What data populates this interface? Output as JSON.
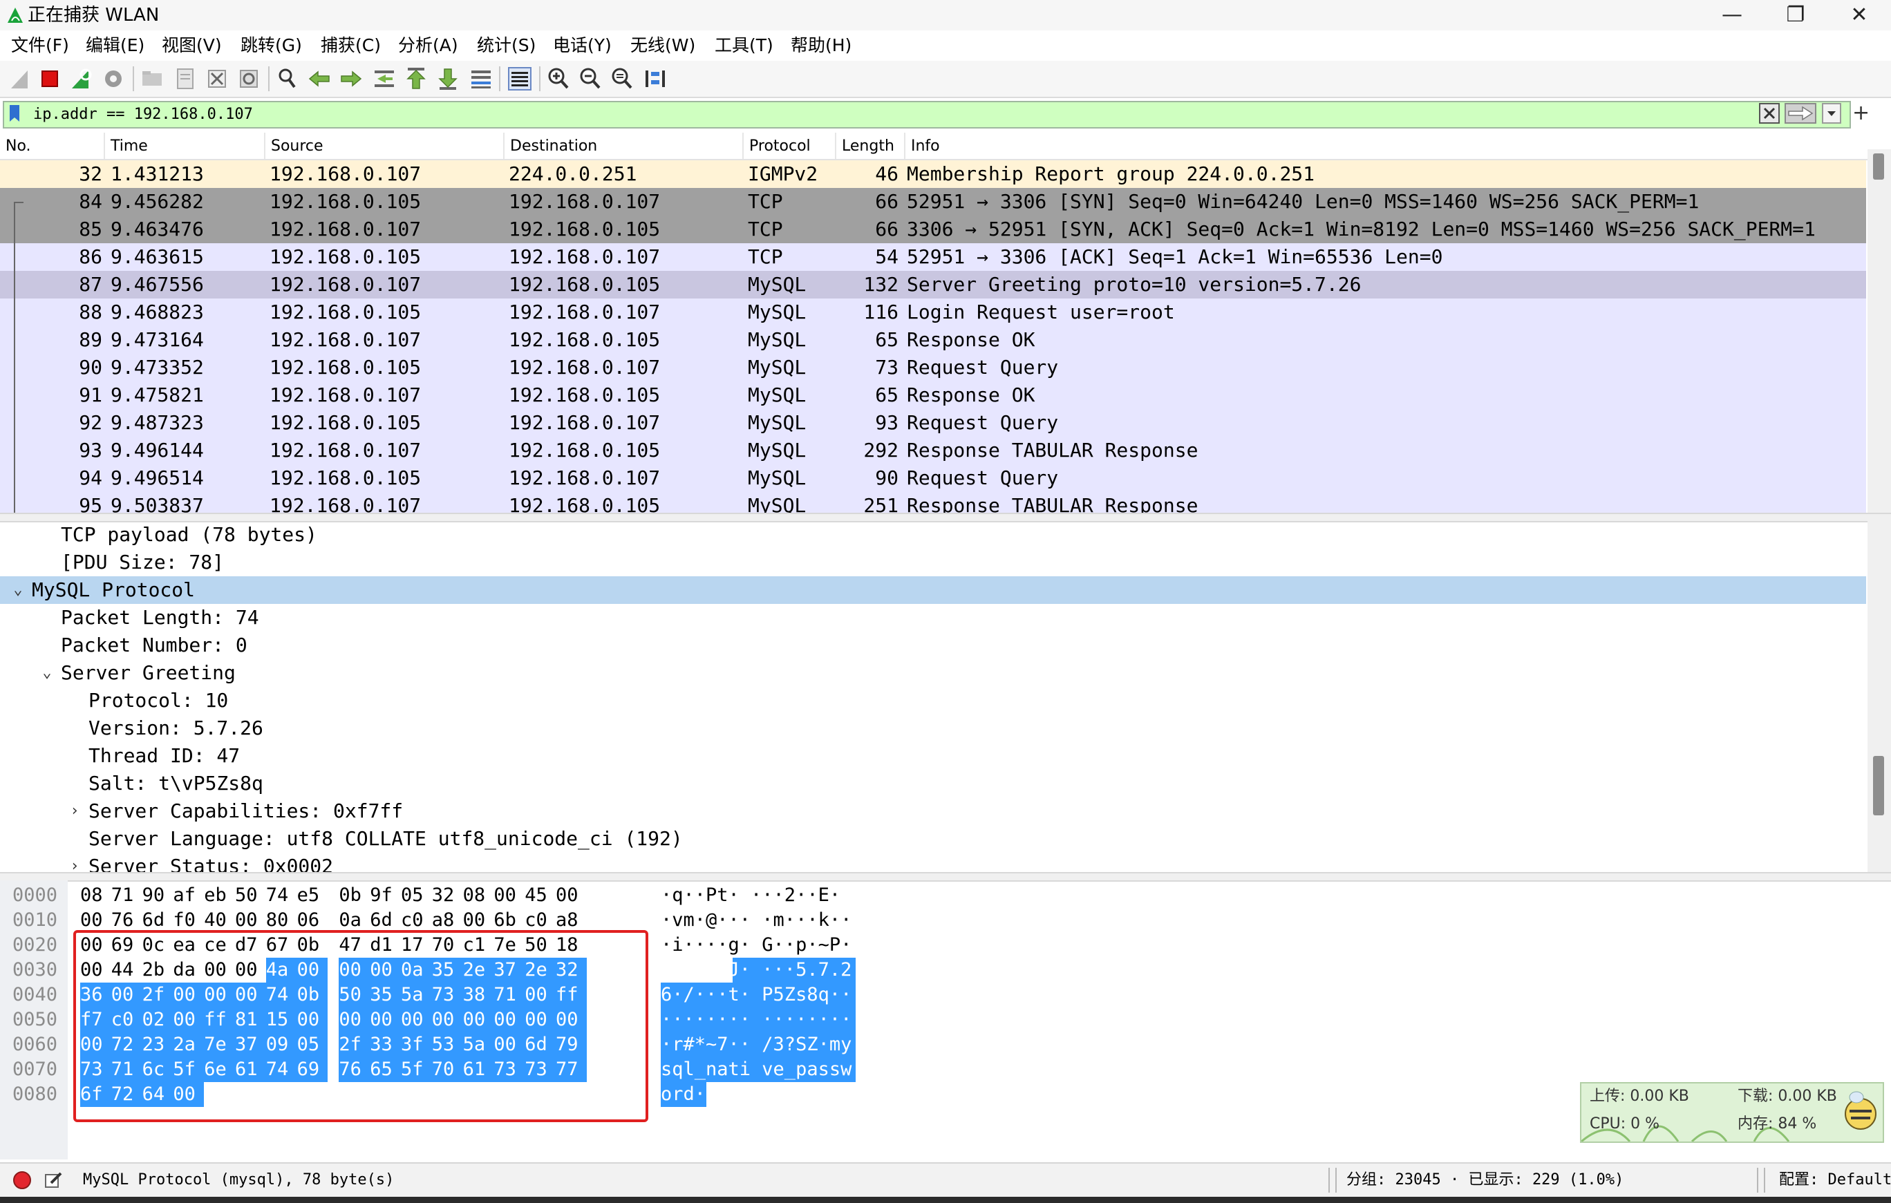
{
  "window": {
    "title": "正在捕获 WLAN",
    "minimize_glyph": "—",
    "maximize_glyph": "❐",
    "close_glyph": "✕"
  },
  "menu": [
    "文件(F)",
    "编辑(E)",
    "视图(V)",
    "跳转(G)",
    "捕获(C)",
    "分析(A)",
    "统计(S)",
    "电话(Y)",
    "无线(W)",
    "工具(T)",
    "帮助(H)"
  ],
  "toolbar_icons": [
    "shark-fin-start-icon",
    "stop-capture-icon",
    "restart-capture-icon",
    "capture-options-icon",
    "open-file-icon",
    "save-file-icon",
    "close-file-icon",
    "reload-file-icon",
    "find-packet-icon",
    "go-back-icon",
    "go-forward-icon",
    "go-to-packet-icon",
    "first-packet-icon",
    "last-packet-icon",
    "auto-scroll-icon",
    "colorize-icon",
    "zoom-in-icon",
    "zoom-out-icon",
    "normal-size-icon",
    "resize-columns-icon"
  ],
  "filter": {
    "value": "ip.addr == 192.168.0.107",
    "add_glyph": "+"
  },
  "packet_list": {
    "columns": [
      "No.",
      "Time",
      "Source",
      "Destination",
      "Protocol",
      "Length",
      "Info"
    ],
    "rows": [
      {
        "no": "32",
        "time": "1.431213",
        "src": "192.168.0.107",
        "dst": "224.0.0.251",
        "proto": "IGMPv2",
        "len": "46",
        "info": "Membership Report group 224.0.0.251",
        "bg": "#fff3d6"
      },
      {
        "no": "84",
        "time": "9.456282",
        "src": "192.168.0.105",
        "dst": "192.168.0.107",
        "proto": "TCP",
        "len": "66",
        "info": "52951 → 3306 [SYN] Seq=0 Win=64240 Len=0 MSS=1460 WS=256 SACK_PERM=1",
        "bg": "#a0a0a0"
      },
      {
        "no": "85",
        "time": "9.463476",
        "src": "192.168.0.107",
        "dst": "192.168.0.105",
        "proto": "TCP",
        "len": "66",
        "info": "3306 → 52951 [SYN, ACK] Seq=0 Ack=1 Win=8192 Len=0 MSS=1460 WS=256 SACK_PERM=1",
        "bg": "#a0a0a0"
      },
      {
        "no": "86",
        "time": "9.463615",
        "src": "192.168.0.105",
        "dst": "192.168.0.107",
        "proto": "TCP",
        "len": "54",
        "info": "52951 → 3306 [ACK] Seq=1 Ack=1 Win=65536 Len=0",
        "bg": "#e7e6ff"
      },
      {
        "no": "87",
        "time": "9.467556",
        "src": "192.168.0.107",
        "dst": "192.168.0.105",
        "proto": "MySQL",
        "len": "132",
        "info": "Server Greeting  proto=10 version=5.7.26",
        "bg": "#c9c6e0"
      },
      {
        "no": "88",
        "time": "9.468823",
        "src": "192.168.0.105",
        "dst": "192.168.0.107",
        "proto": "MySQL",
        "len": "116",
        "info": "Login Request user=root",
        "bg": "#e7e6ff"
      },
      {
        "no": "89",
        "time": "9.473164",
        "src": "192.168.0.107",
        "dst": "192.168.0.105",
        "proto": "MySQL",
        "len": "65",
        "info": "Response  OK",
        "bg": "#e7e6ff"
      },
      {
        "no": "90",
        "time": "9.473352",
        "src": "192.168.0.105",
        "dst": "192.168.0.107",
        "proto": "MySQL",
        "len": "73",
        "info": "Request Query",
        "bg": "#e7e6ff"
      },
      {
        "no": "91",
        "time": "9.475821",
        "src": "192.168.0.107",
        "dst": "192.168.0.105",
        "proto": "MySQL",
        "len": "65",
        "info": "Response  OK",
        "bg": "#e7e6ff"
      },
      {
        "no": "92",
        "time": "9.487323",
        "src": "192.168.0.105",
        "dst": "192.168.0.107",
        "proto": "MySQL",
        "len": "93",
        "info": "Request Query",
        "bg": "#e7e6ff"
      },
      {
        "no": "93",
        "time": "9.496144",
        "src": "192.168.0.107",
        "dst": "192.168.0.105",
        "proto": "MySQL",
        "len": "292",
        "info": "Response TABULAR Response",
        "bg": "#e7e6ff"
      },
      {
        "no": "94",
        "time": "9.496514",
        "src": "192.168.0.105",
        "dst": "192.168.0.107",
        "proto": "MySQL",
        "len": "90",
        "info": "Request Query",
        "bg": "#e7e6ff"
      },
      {
        "no": "95",
        "time": "9.503837",
        "src": "192.168.0.107",
        "dst": "192.168.0.105",
        "proto": "MySQL",
        "len": "251",
        "info": "Response TABULAR Response",
        "bg": "#e7e6ff"
      }
    ]
  },
  "details": [
    {
      "text": "TCP payload (78 bytes)",
      "level": 2,
      "arrow": ""
    },
    {
      "text": "[PDU Size: 78]",
      "level": 2,
      "arrow": ""
    },
    {
      "text": "MySQL Protocol",
      "level": 1,
      "arrow": "open",
      "selected": true
    },
    {
      "text": "Packet Length: 74",
      "level": 2,
      "arrow": ""
    },
    {
      "text": "Packet Number: 0",
      "level": 2,
      "arrow": ""
    },
    {
      "text": "Server Greeting",
      "level": 2,
      "arrow": "open"
    },
    {
      "text": "Protocol: 10",
      "level": 3,
      "arrow": ""
    },
    {
      "text": "Version: 5.7.26",
      "level": 3,
      "arrow": ""
    },
    {
      "text": "Thread ID: 47",
      "level": 3,
      "arrow": ""
    },
    {
      "text": "Salt: t\\vP5Zs8q",
      "level": 3,
      "arrow": ""
    },
    {
      "text": "Server Capabilities: 0xf7ff",
      "level": 3,
      "arrow": "closed"
    },
    {
      "text": "Server Language: utf8 COLLATE utf8_unicode_ci (192)",
      "level": 3,
      "arrow": ""
    },
    {
      "text": "Server Status: 0x0002",
      "level": 3,
      "arrow": "closed"
    }
  ],
  "hex": {
    "highlight_start": 54,
    "lines": [
      {
        "offset": "0000",
        "bytes": [
          "08",
          "71",
          "90",
          "af",
          "eb",
          "50",
          "74",
          "e5",
          "0b",
          "9f",
          "05",
          "32",
          "08",
          "00",
          "45",
          "00"
        ],
        "ascii": "·q··Pt· ···2··E·"
      },
      {
        "offset": "0010",
        "bytes": [
          "00",
          "76",
          "6d",
          "f0",
          "40",
          "00",
          "80",
          "06",
          "0a",
          "6d",
          "c0",
          "a8",
          "00",
          "6b",
          "c0",
          "a8"
        ],
        "ascii": "·vm·@··· ·m···k··"
      },
      {
        "offset": "0020",
        "bytes": [
          "00",
          "69",
          "0c",
          "ea",
          "ce",
          "d7",
          "67",
          "0b",
          "47",
          "d1",
          "17",
          "70",
          "c1",
          "7e",
          "50",
          "18"
        ],
        "ascii": "·i····g· G··p·~P·"
      },
      {
        "offset": "0030",
        "bytes": [
          "00",
          "44",
          "2b",
          "da",
          "00",
          "00",
          "4a",
          "00",
          "00",
          "00",
          "0a",
          "35",
          "2e",
          "37",
          "2e",
          "32"
        ],
        "ascii": "·D+···J· ···5.7.2"
      },
      {
        "offset": "0040",
        "bytes": [
          "36",
          "00",
          "2f",
          "00",
          "00",
          "00",
          "74",
          "0b",
          "50",
          "35",
          "5a",
          "73",
          "38",
          "71",
          "00",
          "ff"
        ],
        "ascii": "6·/···t· P5Zs8q··"
      },
      {
        "offset": "0050",
        "bytes": [
          "f7",
          "c0",
          "02",
          "00",
          "ff",
          "81",
          "15",
          "00",
          "00",
          "00",
          "00",
          "00",
          "00",
          "00",
          "00",
          "00"
        ],
        "ascii": "········ ········"
      },
      {
        "offset": "0060",
        "bytes": [
          "00",
          "72",
          "23",
          "2a",
          "7e",
          "37",
          "09",
          "05",
          "2f",
          "33",
          "3f",
          "53",
          "5a",
          "00",
          "6d",
          "79"
        ],
        "ascii": "·r#*~7·· /3?SZ·my"
      },
      {
        "offset": "0070",
        "bytes": [
          "73",
          "71",
          "6c",
          "5f",
          "6e",
          "61",
          "74",
          "69",
          "76",
          "65",
          "5f",
          "70",
          "61",
          "73",
          "73",
          "77"
        ],
        "ascii": "sql_nati ve_passw"
      },
      {
        "offset": "0080",
        "bytes": [
          "6f",
          "72",
          "64",
          "00"
        ],
        "ascii": "ord·"
      }
    ]
  },
  "net_widget": {
    "upload": "上传: 0.00 KB",
    "download": "下载: 0.00 KB",
    "cpu": "CPU: 0 %",
    "memory": "内存: 84 %"
  },
  "status": {
    "field_info": "MySQL Protocol (mysql), 78 byte(s)",
    "packets": "分组: 23045 · 已显示: 229 (1.0%)",
    "profile": "配置: Default"
  }
}
